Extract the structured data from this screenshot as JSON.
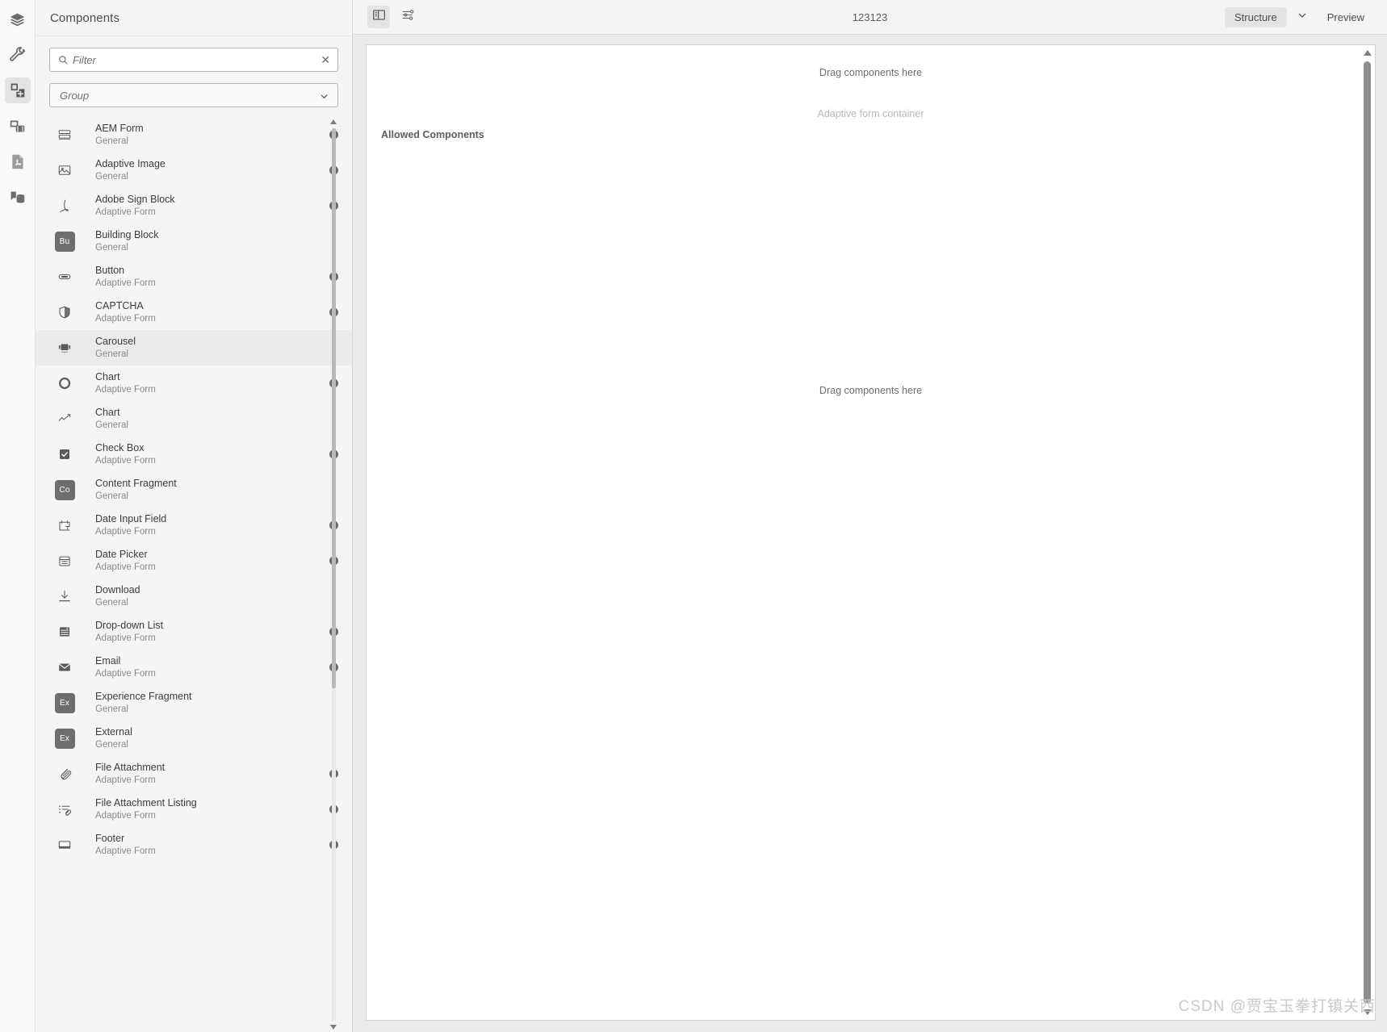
{
  "rail": {
    "items": [
      {
        "name": "layers-icon",
        "selected": false
      },
      {
        "name": "wrench-icon",
        "selected": false
      },
      {
        "name": "components-icon",
        "selected": true
      },
      {
        "name": "assets-icon",
        "selected": false
      },
      {
        "name": "pdf-document-icon",
        "selected": false
      },
      {
        "name": "content-tree-icon",
        "selected": false
      }
    ]
  },
  "panel": {
    "title": "Components",
    "filter": {
      "value": "",
      "placeholder": "Filter",
      "clear_label": "✕"
    },
    "group": {
      "value": "Group",
      "placeholder": "Group"
    },
    "components": [
      {
        "title": "AEM Form",
        "group": "General",
        "icon": "aem-form-icon",
        "info": true
      },
      {
        "title": "Adaptive Image",
        "group": "General",
        "icon": "image-icon",
        "info": true
      },
      {
        "title": "Adobe Sign Block",
        "group": "Adaptive Form",
        "icon": "adobe-sign-icon",
        "info": true
      },
      {
        "title": "Building Block",
        "group": "General",
        "icon": "badge",
        "badge": "Bu",
        "info": false
      },
      {
        "title": "Button",
        "group": "Adaptive Form",
        "icon": "button-icon",
        "info": true
      },
      {
        "title": "CAPTCHA",
        "group": "Adaptive Form",
        "icon": "shield-icon",
        "info": true
      },
      {
        "title": "Carousel",
        "group": "General",
        "icon": "carousel-icon",
        "info": false,
        "active": true
      },
      {
        "title": "Chart",
        "group": "Adaptive Form",
        "icon": "donut-chart-icon",
        "info": true
      },
      {
        "title": "Chart",
        "group": "General",
        "icon": "line-chart-icon",
        "info": false
      },
      {
        "title": "Check Box",
        "group": "Adaptive Form",
        "icon": "checkbox-icon",
        "info": true
      },
      {
        "title": "Content Fragment",
        "group": "General",
        "icon": "badge",
        "badge": "Co",
        "info": false
      },
      {
        "title": "Date Input Field",
        "group": "Adaptive Form",
        "icon": "date-input-icon",
        "info": true
      },
      {
        "title": "Date Picker",
        "group": "Adaptive Form",
        "icon": "calendar-icon",
        "info": true
      },
      {
        "title": "Download",
        "group": "General",
        "icon": "download-icon",
        "info": false
      },
      {
        "title": "Drop-down List",
        "group": "Adaptive Form",
        "icon": "dropdown-icon",
        "info": true
      },
      {
        "title": "Email",
        "group": "Adaptive Form",
        "icon": "email-icon",
        "info": true
      },
      {
        "title": "Experience Fragment",
        "group": "General",
        "icon": "badge",
        "badge": "Ex",
        "info": false
      },
      {
        "title": "External",
        "group": "General",
        "icon": "badge",
        "badge": "Ex",
        "info": false
      },
      {
        "title": "File Attachment",
        "group": "Adaptive Form",
        "icon": "paperclip-icon",
        "info": true
      },
      {
        "title": "File Attachment Listing",
        "group": "Adaptive Form",
        "icon": "attachment-list-icon",
        "info": true
      },
      {
        "title": "Footer",
        "group": "Adaptive Form",
        "icon": "footer-icon",
        "info": true
      }
    ]
  },
  "toolbar": {
    "panel_toggle_name": "side-panel-toggle-icon",
    "properties_name": "sliders-icon",
    "title": "123123",
    "mode_selected": "Structure",
    "mode_preview": "Preview"
  },
  "canvas": {
    "drop_hint_top": "Drag components here",
    "container_label": "Adaptive form container",
    "allowed_components": "Allowed Components",
    "drop_hint_bottom": "Drag components here"
  },
  "watermark": "CSDN @贾宝玉拳打镇关西"
}
